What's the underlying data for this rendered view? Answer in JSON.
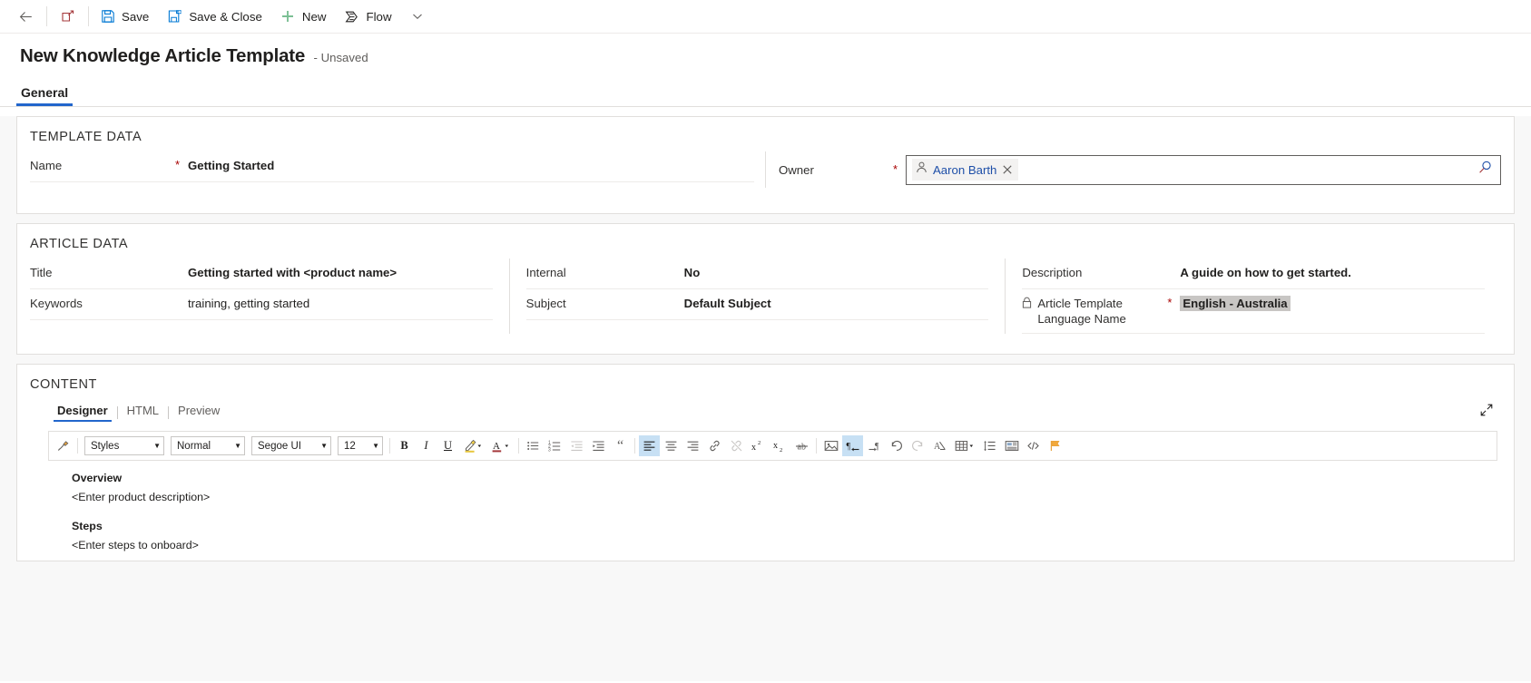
{
  "commandbar": {
    "back_label": "",
    "items": [
      {
        "name": "back",
        "label": "",
        "icon": "arrow-left-icon"
      },
      {
        "name": "popout",
        "label": "",
        "icon": "open-in-new-window-icon"
      },
      {
        "name": "save",
        "label": "Save",
        "icon": "save-icon"
      },
      {
        "name": "save-and-close",
        "label": "Save & Close",
        "icon": "save-and-close-icon"
      },
      {
        "name": "new",
        "label": "New",
        "icon": "plus-icon"
      },
      {
        "name": "flow",
        "label": "Flow",
        "icon": "flow-icon"
      },
      {
        "name": "overflow",
        "label": "",
        "icon": "chevron-down-icon"
      }
    ]
  },
  "header": {
    "title": "New Knowledge Article Template",
    "status": "- Unsaved"
  },
  "tabs": [
    {
      "label": "General",
      "active": true
    }
  ],
  "template_data": {
    "section_title": "TEMPLATE DATA",
    "name": {
      "label": "Name",
      "required": "*",
      "value": "Getting Started"
    },
    "owner": {
      "label": "Owner",
      "required": "*",
      "value": "Aaron Barth",
      "person_icon": "person-icon",
      "remove_icon": "close-icon",
      "search_icon": "search-icon"
    }
  },
  "article_data": {
    "section_title": "ARTICLE DATA",
    "title": {
      "label": "Title",
      "value": "Getting started with <product name>"
    },
    "keywords": {
      "label": "Keywords",
      "value": "training, getting started"
    },
    "internal": {
      "label": "Internal",
      "value": "No"
    },
    "subject": {
      "label": "Subject",
      "value": "Default Subject"
    },
    "description": {
      "label": "Description",
      "value": "A guide on how to get started."
    },
    "language": {
      "label_line1": "Article Template",
      "label_line2": "Language Name",
      "required": "*",
      "lock_icon": "lock-icon",
      "value": "English - Australia"
    }
  },
  "content": {
    "section_title": "CONTENT",
    "editor_tabs": [
      {
        "label": "Designer",
        "active": true
      },
      {
        "label": "HTML",
        "active": false
      },
      {
        "label": "Preview",
        "active": false
      }
    ],
    "expand_icon": "expand-diagonal-icon",
    "toolbar": {
      "selects": [
        {
          "name": "styles-select",
          "value": "Styles"
        },
        {
          "name": "format-select",
          "value": "Normal"
        },
        {
          "name": "font-family-select",
          "value": "Segoe UI"
        },
        {
          "name": "font-size-select",
          "value": "12"
        }
      ],
      "buttons": [
        {
          "name": "format-painter-button",
          "icon": "format-painter-icon",
          "glyph": "",
          "state": ""
        },
        {
          "name": "bold-button",
          "icon": "bold-icon",
          "glyph": "B",
          "state": ""
        },
        {
          "name": "italic-button",
          "icon": "italic-icon",
          "glyph": "I",
          "state": ""
        },
        {
          "name": "underline-button",
          "icon": "underline-icon",
          "glyph": "U",
          "state": ""
        },
        {
          "name": "highlight-color-button",
          "icon": "highlighter-icon",
          "glyph": "",
          "state": ""
        },
        {
          "name": "font-color-button",
          "icon": "font-color-icon",
          "glyph": "A",
          "state": ""
        },
        {
          "name": "bulleted-list-button",
          "icon": "bulleted-list-icon",
          "glyph": "",
          "state": ""
        },
        {
          "name": "numbered-list-button",
          "icon": "numbered-list-icon",
          "glyph": "",
          "state": ""
        },
        {
          "name": "decrease-indent-button",
          "icon": "decrease-indent-icon",
          "glyph": "",
          "state": "disabled"
        },
        {
          "name": "increase-indent-button",
          "icon": "increase-indent-icon",
          "glyph": "",
          "state": ""
        },
        {
          "name": "blockquote-button",
          "icon": "quote-icon",
          "glyph": "",
          "state": ""
        },
        {
          "name": "align-left-button",
          "icon": "align-left-icon",
          "glyph": "",
          "state": "on"
        },
        {
          "name": "align-center-button",
          "icon": "align-center-icon",
          "glyph": "",
          "state": ""
        },
        {
          "name": "align-right-button",
          "icon": "align-right-icon",
          "glyph": "",
          "state": ""
        },
        {
          "name": "insert-link-button",
          "icon": "link-icon",
          "glyph": "",
          "state": ""
        },
        {
          "name": "remove-link-button",
          "icon": "unlink-icon",
          "glyph": "",
          "state": "disabled"
        },
        {
          "name": "superscript-button",
          "icon": "superscript-icon",
          "glyph": "",
          "state": ""
        },
        {
          "name": "subscript-button",
          "icon": "subscript-icon",
          "glyph": "",
          "state": ""
        },
        {
          "name": "strikethrough-button",
          "icon": "strikethrough-icon",
          "glyph": "",
          "state": ""
        },
        {
          "name": "insert-image-button",
          "icon": "image-icon",
          "glyph": "",
          "state": ""
        },
        {
          "name": "rtl-button",
          "icon": "right-to-left-icon",
          "glyph": "",
          "state": "on"
        },
        {
          "name": "ltr-button",
          "icon": "left-to-right-icon",
          "glyph": "",
          "state": ""
        },
        {
          "name": "undo-button",
          "icon": "undo-icon",
          "glyph": "",
          "state": ""
        },
        {
          "name": "redo-button",
          "icon": "redo-icon",
          "glyph": "",
          "state": "disabled"
        },
        {
          "name": "clear-format-button",
          "icon": "clear-formatting-icon",
          "glyph": "",
          "state": ""
        },
        {
          "name": "table-button",
          "icon": "table-icon",
          "glyph": "",
          "state": ""
        },
        {
          "name": "line-spacing-button",
          "icon": "line-spacing-icon",
          "glyph": "",
          "state": ""
        },
        {
          "name": "insert-template-button",
          "icon": "insert-template-icon",
          "glyph": "",
          "state": ""
        },
        {
          "name": "view-source-button",
          "icon": "code-icon",
          "glyph": "",
          "state": ""
        },
        {
          "name": "flag-button",
          "icon": "flag-icon",
          "glyph": "",
          "state": ""
        }
      ]
    },
    "document": [
      {
        "type": "heading",
        "text": "Overview"
      },
      {
        "type": "paragraph",
        "text": "<Enter product description>"
      },
      {
        "type": "heading",
        "text": "Steps"
      },
      {
        "type": "paragraph",
        "text": "<Enter steps to onboard>"
      }
    ]
  },
  "colors": {
    "accent": "#2266cc",
    "required": "#a80000",
    "link": "#1e4fa8",
    "toolbar_active": "#c7e0f4",
    "selection": "#c8c6c4"
  }
}
